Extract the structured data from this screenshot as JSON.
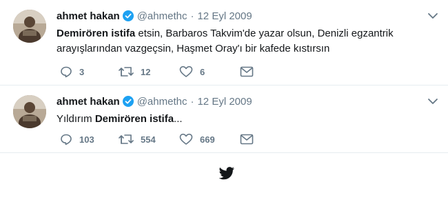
{
  "colors": {
    "text": "#14171a",
    "muted": "#657786",
    "verified": "#1da1f2",
    "divider": "#e6ecf0",
    "bird": "#14171a"
  },
  "tweets": [
    {
      "name": "ahmet hakan",
      "handle": "@ahmethc",
      "separator": "·",
      "date": "12 Eyl 2009",
      "text_bold": "Demirören istifa",
      "text_rest": " etsin, Barbaros Takvim'de yazar olsun, Denizli egzantrik arayışlarından vazgeçsin, Haşmet Oray'ı bir kafede kıstırsın",
      "replies": "3",
      "retweets": "12",
      "likes": "6",
      "icons": [
        "verified-badge-icon",
        "chevron-down-icon",
        "reply-icon",
        "retweet-icon",
        "like-heart-icon",
        "direct-message-icon"
      ]
    },
    {
      "name": "ahmet hakan",
      "handle": "@ahmethc",
      "separator": "·",
      "date": "12 Eyl 2009",
      "text_pre": "Yıldırım ",
      "text_bold": "Demirören istifa",
      "text_post": "...",
      "replies": "103",
      "retweets": "554",
      "likes": "669",
      "icons": [
        "verified-badge-icon",
        "chevron-down-icon",
        "reply-icon",
        "retweet-icon",
        "like-heart-icon",
        "direct-message-icon"
      ]
    }
  ],
  "footer": {
    "icon": "twitter-bird-icon"
  }
}
